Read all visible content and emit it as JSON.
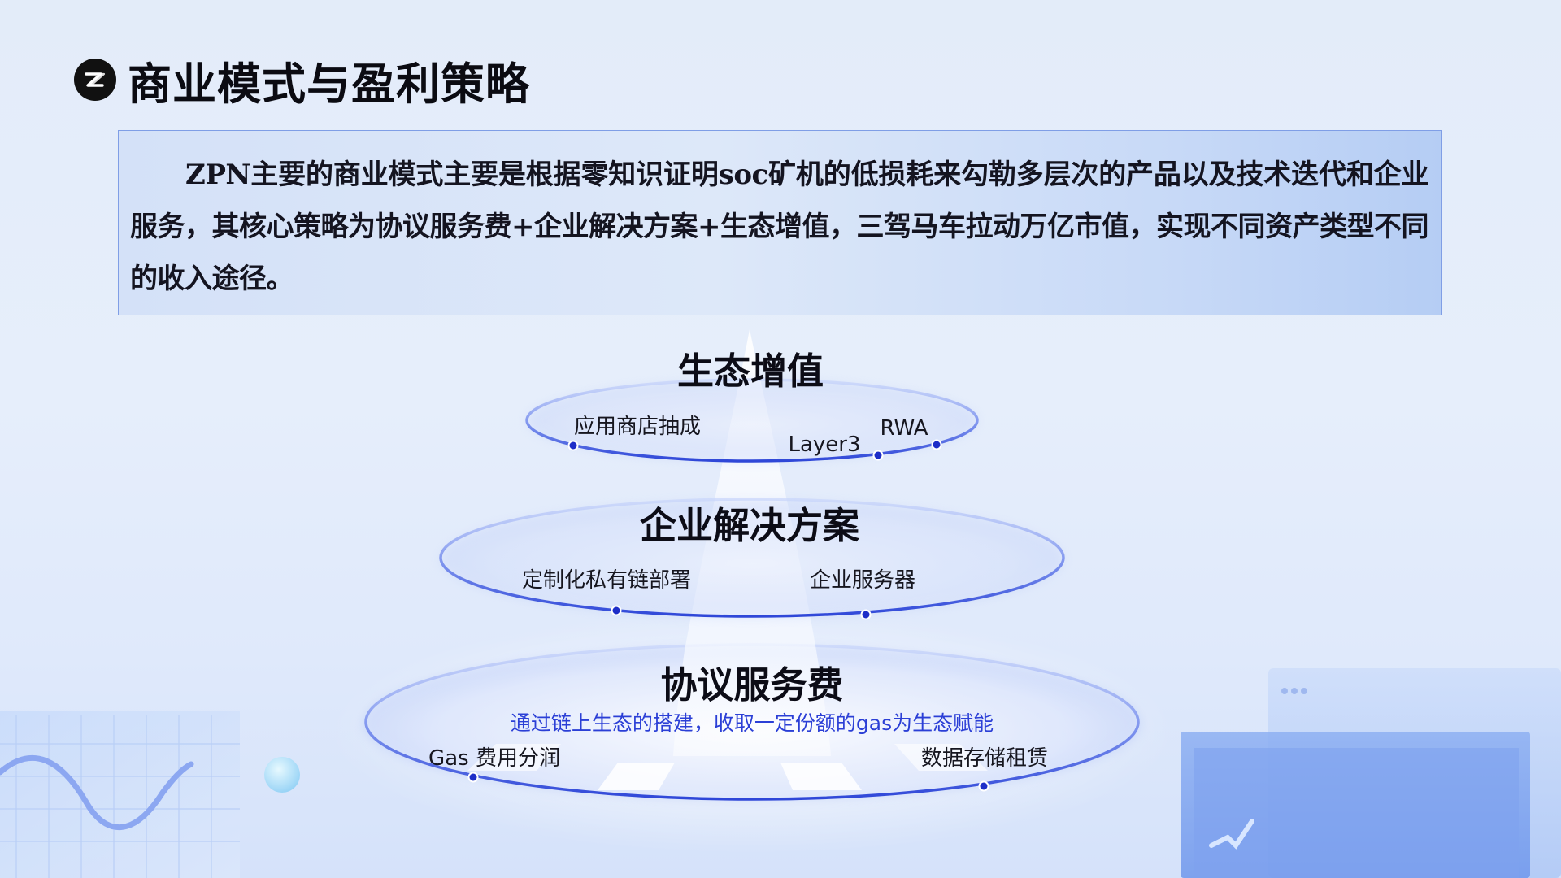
{
  "slide": {
    "title": "商业模式与盈利策略",
    "intro": "ZPN主要的商业模式主要是根据零知识证明soc矿机的低损耗来勾勒多层次的产品以及技术迭代和企业服务，其核心策略为协议服务费+企业解决方案+生态增值，三驾马车拉动万亿市值，实现不同资产类型不同的收入途径。"
  },
  "pyramid": {
    "top": {
      "title": "生态增值",
      "items": [
        "应用商店抽成",
        "Layer3",
        "RWA"
      ]
    },
    "middle": {
      "title": "企业解决方案",
      "items": [
        "定制化私有链部署",
        "企业服务器"
      ]
    },
    "bottom": {
      "title": "协议服务费",
      "description": "通过链上生态的搭建，收取一定份额的gas为生态赋能",
      "items": [
        "Gas 费用分润",
        "数据存储租赁"
      ]
    }
  },
  "colors": {
    "accent": "#2f47d8",
    "ring_stroke": "#3d5ae0",
    "description_text": "#2b3fd6",
    "title_text": "#0b0b12"
  },
  "icons": {
    "logo": "zpn-logo-icon"
  }
}
